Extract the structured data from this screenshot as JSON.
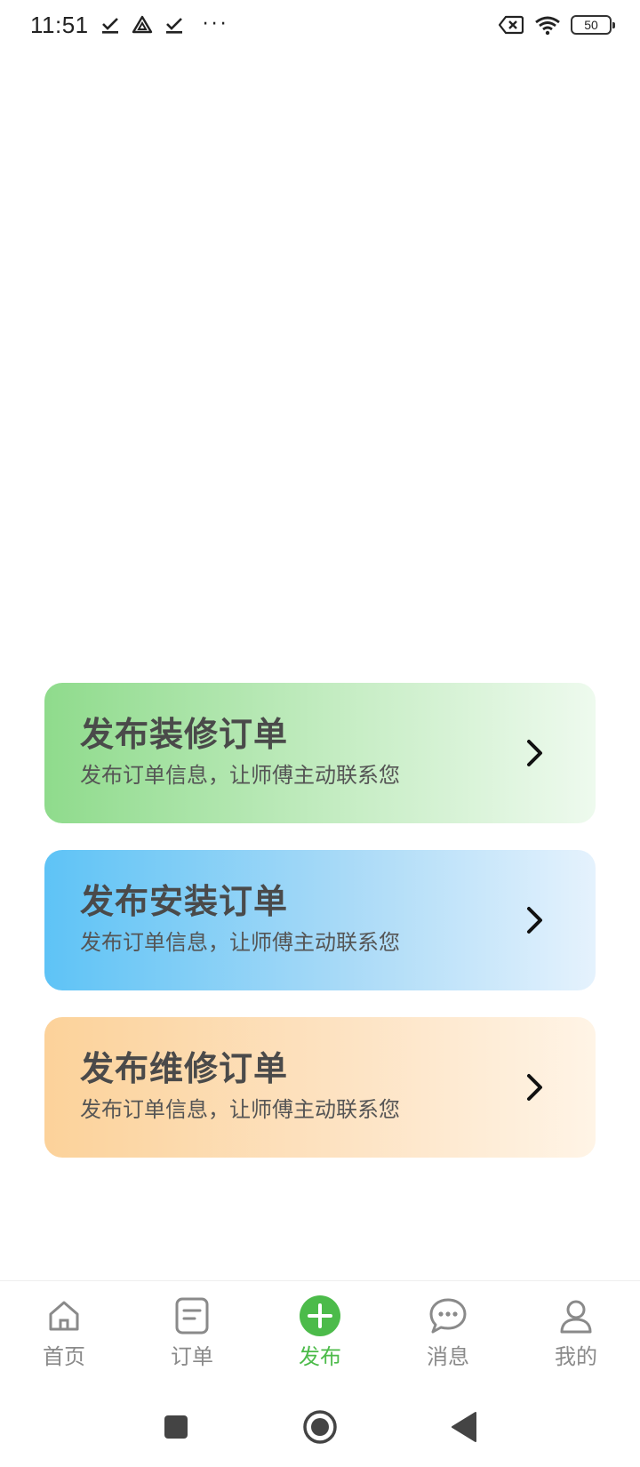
{
  "status_bar": {
    "time": "11:51",
    "icons": [
      "download-done-icon",
      "drive-icon",
      "download-done-icon",
      "more-dots-icon"
    ],
    "dots": "···",
    "right_icons": [
      "no-sim-icon",
      "wifi-icon",
      "battery-icon"
    ],
    "battery": "50"
  },
  "cards": [
    {
      "title": "发布装修订单",
      "subtitle": "发布订单信息，让师傅主动联系您",
      "colors": [
        "#8fdb8c",
        "#eefaee"
      ]
    },
    {
      "title": "发布安装订单",
      "subtitle": "发布订单信息，让师傅主动联系您",
      "colors": [
        "#5ec3f6",
        "#e5f2fd"
      ]
    },
    {
      "title": "发布维修订单",
      "subtitle": "发布订单信息，让师傅主动联系您",
      "colors": [
        "#fcd29a",
        "#fff4e6"
      ]
    }
  ],
  "tabbar": {
    "active_color": "#4cbb4a",
    "inactive_color": "#8a8a8a",
    "tabs": [
      {
        "label": "首页",
        "icon": "home-icon",
        "active": false
      },
      {
        "label": "订单",
        "icon": "order-icon",
        "active": false
      },
      {
        "label": "发布",
        "icon": "plus-circle-icon",
        "active": true
      },
      {
        "label": "消息",
        "icon": "chat-icon",
        "active": false
      },
      {
        "label": "我的",
        "icon": "user-icon",
        "active": false
      }
    ]
  },
  "navbar": {
    "buttons": [
      "recents-square-icon",
      "home-circle-icon",
      "back-triangle-icon"
    ]
  }
}
